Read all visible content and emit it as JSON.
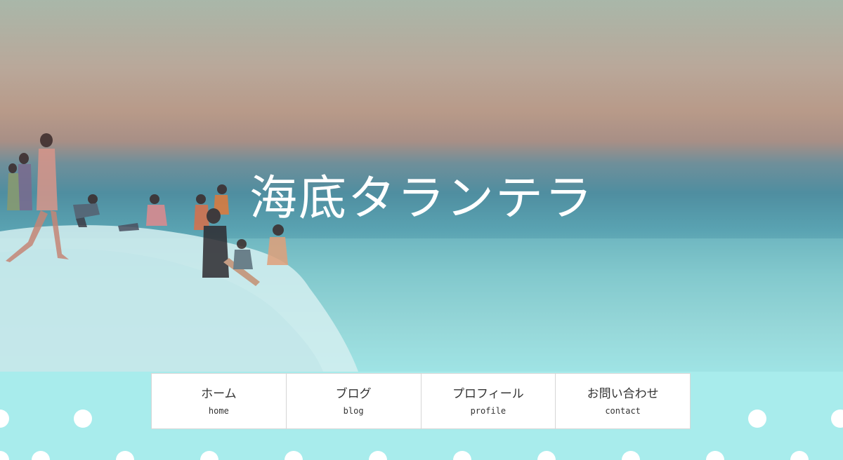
{
  "site": {
    "title": "海底タランテラ"
  },
  "nav": {
    "items": [
      {
        "label": "ホーム",
        "sub": "home"
      },
      {
        "label": "ブログ",
        "sub": "blog"
      },
      {
        "label": "プロフィール",
        "sub": "profile"
      },
      {
        "label": "お問い合わせ",
        "sub": "contact"
      }
    ]
  },
  "colors": {
    "accent_background": "#a8ecec",
    "nav_background": "#ffffff",
    "nav_border": "#d6d6d6",
    "title_text": "#ffffff"
  }
}
